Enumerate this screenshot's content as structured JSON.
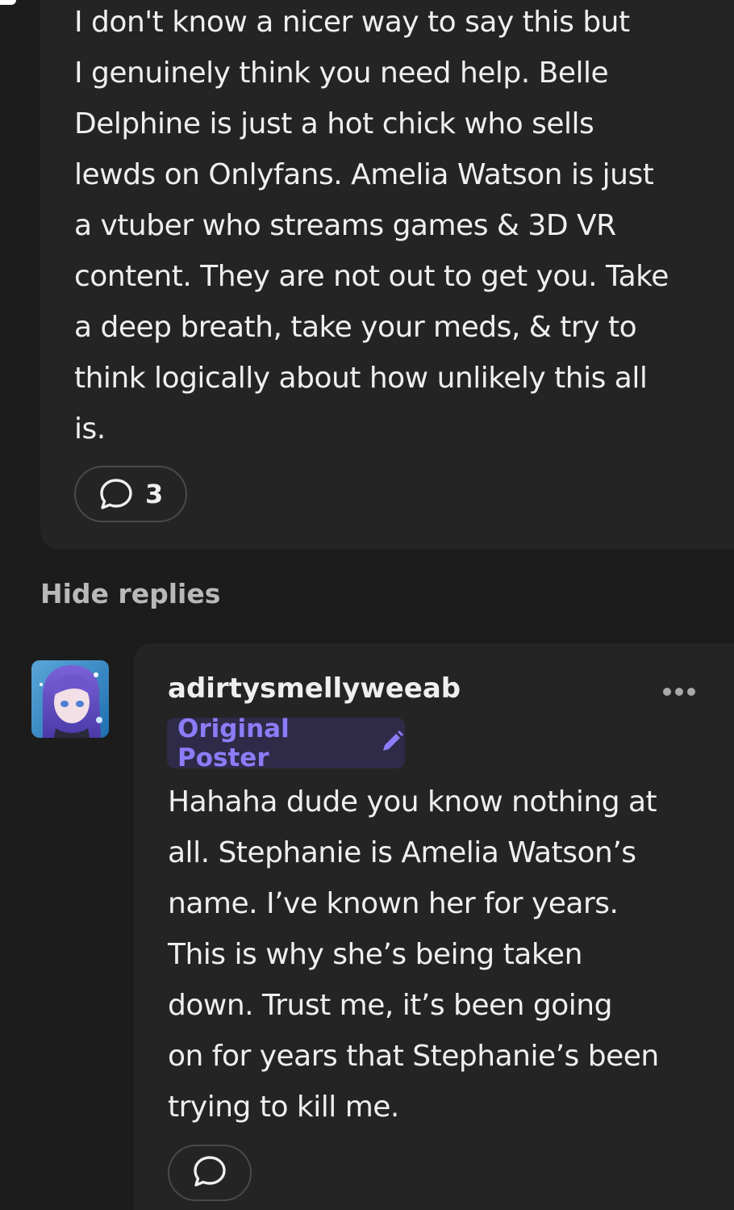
{
  "parent_comment": {
    "text": "I don't know a nicer way to say this but\nI genuinely think you need help. Belle\nDelphine is just a hot chick who sells\nlewds on Onlyfans. Amelia Watson is just\na vtuber who streams games & 3D VR\ncontent. They are not out to get you. Take\na deep breath, take your meds, & try to\nthink logically about how unlikely this all\nis.",
    "reply_count": "3",
    "reply_icon": "speech-bubble-icon"
  },
  "thread": {
    "hide_replies_label": "Hide replies"
  },
  "reply": {
    "username": "adirtysmellyweeab",
    "badge_label": "Original Poster",
    "badge_icon": "pencil-icon",
    "more_icon": "more-dots-icon",
    "text": "Hahaha dude you know nothing at\nall. Stephanie is Amelia Watson’s\nname. I’ve known her for years.\nThis is why she’s being taken\ndown. Trust me, it’s been going\non for years that Stephanie’s been\ntrying to kill me.",
    "reply_icon": "speech-bubble-icon"
  },
  "colors": {
    "background": "#1c1c1c",
    "card": "#242424",
    "badge_bg": "#2f2a48",
    "badge_accent": "#8c7cf7",
    "muted_text": "#b9b9b9"
  }
}
